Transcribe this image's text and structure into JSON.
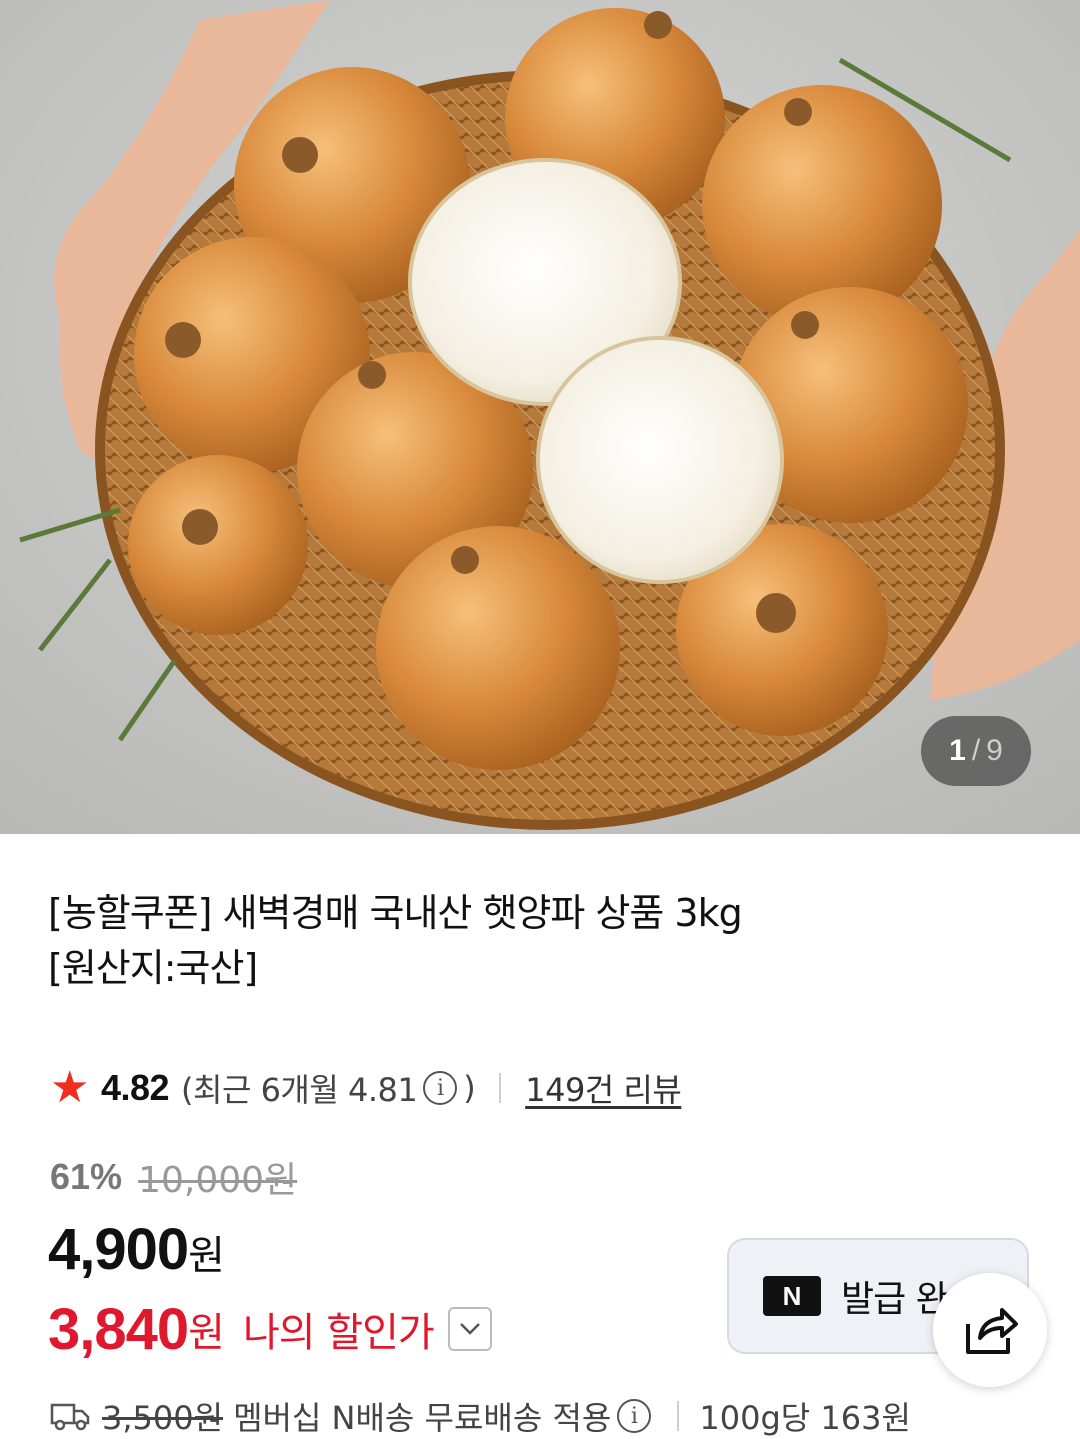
{
  "image_counter": {
    "current": "1",
    "separator": "/",
    "total": "9"
  },
  "product": {
    "title_line1": "[농할쿠폰] 새벽경매 국내산 햇양파 상품 3kg",
    "title_line2": "[원산지:국산]"
  },
  "rating": {
    "score": "4.82",
    "recent_open": "(최근 6개월 4.81",
    "recent_close": ")",
    "info_glyph": "i",
    "reviews": "149건 리뷰"
  },
  "pricing": {
    "discount_percent": "61%",
    "original_price": "10,000원",
    "price_value": "4,900",
    "price_unit": "원",
    "my_price_value": "3,840",
    "my_price_unit": "원",
    "my_price_label": "나의 할인가"
  },
  "coupon": {
    "logo": "N",
    "label": "발급 완"
  },
  "shipping": {
    "original_fee": "3,500원",
    "text": "멤버십 N배송 무료배송 적용",
    "unit_price": "100g당 163원"
  },
  "colors": {
    "accent_red": "#e0182d",
    "star": "#f22c1e"
  },
  "icons": [
    "star-icon",
    "info-icon",
    "chevron-down-icon",
    "share-icon",
    "truck-icon",
    "naver-n-logo"
  ]
}
